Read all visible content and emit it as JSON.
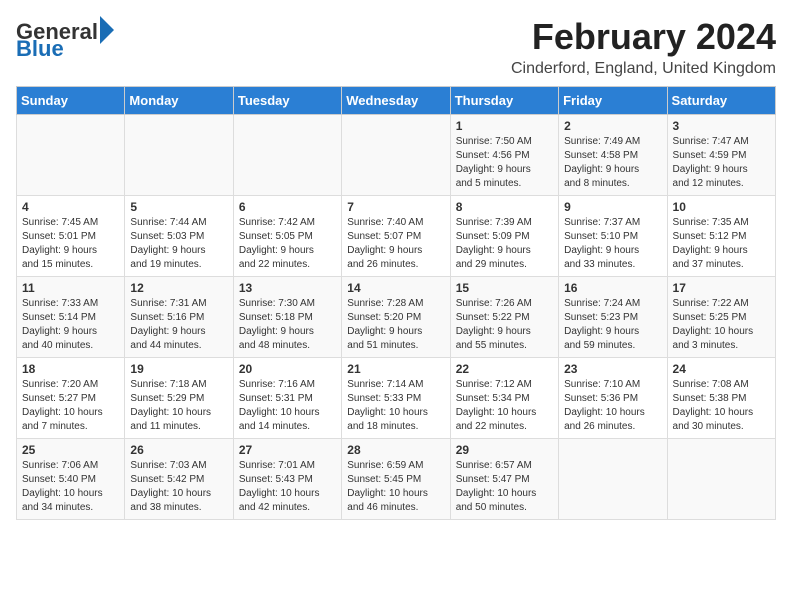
{
  "logo": {
    "general": "General",
    "blue": "Blue"
  },
  "title": "February 2024",
  "subtitle": "Cinderford, England, United Kingdom",
  "headers": [
    "Sunday",
    "Monday",
    "Tuesday",
    "Wednesday",
    "Thursday",
    "Friday",
    "Saturday"
  ],
  "weeks": [
    [
      {
        "day": "",
        "info": ""
      },
      {
        "day": "",
        "info": ""
      },
      {
        "day": "",
        "info": ""
      },
      {
        "day": "",
        "info": ""
      },
      {
        "day": "1",
        "info": "Sunrise: 7:50 AM\nSunset: 4:56 PM\nDaylight: 9 hours\nand 5 minutes."
      },
      {
        "day": "2",
        "info": "Sunrise: 7:49 AM\nSunset: 4:58 PM\nDaylight: 9 hours\nand 8 minutes."
      },
      {
        "day": "3",
        "info": "Sunrise: 7:47 AM\nSunset: 4:59 PM\nDaylight: 9 hours\nand 12 minutes."
      }
    ],
    [
      {
        "day": "4",
        "info": "Sunrise: 7:45 AM\nSunset: 5:01 PM\nDaylight: 9 hours\nand 15 minutes."
      },
      {
        "day": "5",
        "info": "Sunrise: 7:44 AM\nSunset: 5:03 PM\nDaylight: 9 hours\nand 19 minutes."
      },
      {
        "day": "6",
        "info": "Sunrise: 7:42 AM\nSunset: 5:05 PM\nDaylight: 9 hours\nand 22 minutes."
      },
      {
        "day": "7",
        "info": "Sunrise: 7:40 AM\nSunset: 5:07 PM\nDaylight: 9 hours\nand 26 minutes."
      },
      {
        "day": "8",
        "info": "Sunrise: 7:39 AM\nSunset: 5:09 PM\nDaylight: 9 hours\nand 29 minutes."
      },
      {
        "day": "9",
        "info": "Sunrise: 7:37 AM\nSunset: 5:10 PM\nDaylight: 9 hours\nand 33 minutes."
      },
      {
        "day": "10",
        "info": "Sunrise: 7:35 AM\nSunset: 5:12 PM\nDaylight: 9 hours\nand 37 minutes."
      }
    ],
    [
      {
        "day": "11",
        "info": "Sunrise: 7:33 AM\nSunset: 5:14 PM\nDaylight: 9 hours\nand 40 minutes."
      },
      {
        "day": "12",
        "info": "Sunrise: 7:31 AM\nSunset: 5:16 PM\nDaylight: 9 hours\nand 44 minutes."
      },
      {
        "day": "13",
        "info": "Sunrise: 7:30 AM\nSunset: 5:18 PM\nDaylight: 9 hours\nand 48 minutes."
      },
      {
        "day": "14",
        "info": "Sunrise: 7:28 AM\nSunset: 5:20 PM\nDaylight: 9 hours\nand 51 minutes."
      },
      {
        "day": "15",
        "info": "Sunrise: 7:26 AM\nSunset: 5:22 PM\nDaylight: 9 hours\nand 55 minutes."
      },
      {
        "day": "16",
        "info": "Sunrise: 7:24 AM\nSunset: 5:23 PM\nDaylight: 9 hours\nand 59 minutes."
      },
      {
        "day": "17",
        "info": "Sunrise: 7:22 AM\nSunset: 5:25 PM\nDaylight: 10 hours\nand 3 minutes."
      }
    ],
    [
      {
        "day": "18",
        "info": "Sunrise: 7:20 AM\nSunset: 5:27 PM\nDaylight: 10 hours\nand 7 minutes."
      },
      {
        "day": "19",
        "info": "Sunrise: 7:18 AM\nSunset: 5:29 PM\nDaylight: 10 hours\nand 11 minutes."
      },
      {
        "day": "20",
        "info": "Sunrise: 7:16 AM\nSunset: 5:31 PM\nDaylight: 10 hours\nand 14 minutes."
      },
      {
        "day": "21",
        "info": "Sunrise: 7:14 AM\nSunset: 5:33 PM\nDaylight: 10 hours\nand 18 minutes."
      },
      {
        "day": "22",
        "info": "Sunrise: 7:12 AM\nSunset: 5:34 PM\nDaylight: 10 hours\nand 22 minutes."
      },
      {
        "day": "23",
        "info": "Sunrise: 7:10 AM\nSunset: 5:36 PM\nDaylight: 10 hours\nand 26 minutes."
      },
      {
        "day": "24",
        "info": "Sunrise: 7:08 AM\nSunset: 5:38 PM\nDaylight: 10 hours\nand 30 minutes."
      }
    ],
    [
      {
        "day": "25",
        "info": "Sunrise: 7:06 AM\nSunset: 5:40 PM\nDaylight: 10 hours\nand 34 minutes."
      },
      {
        "day": "26",
        "info": "Sunrise: 7:03 AM\nSunset: 5:42 PM\nDaylight: 10 hours\nand 38 minutes."
      },
      {
        "day": "27",
        "info": "Sunrise: 7:01 AM\nSunset: 5:43 PM\nDaylight: 10 hours\nand 42 minutes."
      },
      {
        "day": "28",
        "info": "Sunrise: 6:59 AM\nSunset: 5:45 PM\nDaylight: 10 hours\nand 46 minutes."
      },
      {
        "day": "29",
        "info": "Sunrise: 6:57 AM\nSunset: 5:47 PM\nDaylight: 10 hours\nand 50 minutes."
      },
      {
        "day": "",
        "info": ""
      },
      {
        "day": "",
        "info": ""
      }
    ]
  ]
}
